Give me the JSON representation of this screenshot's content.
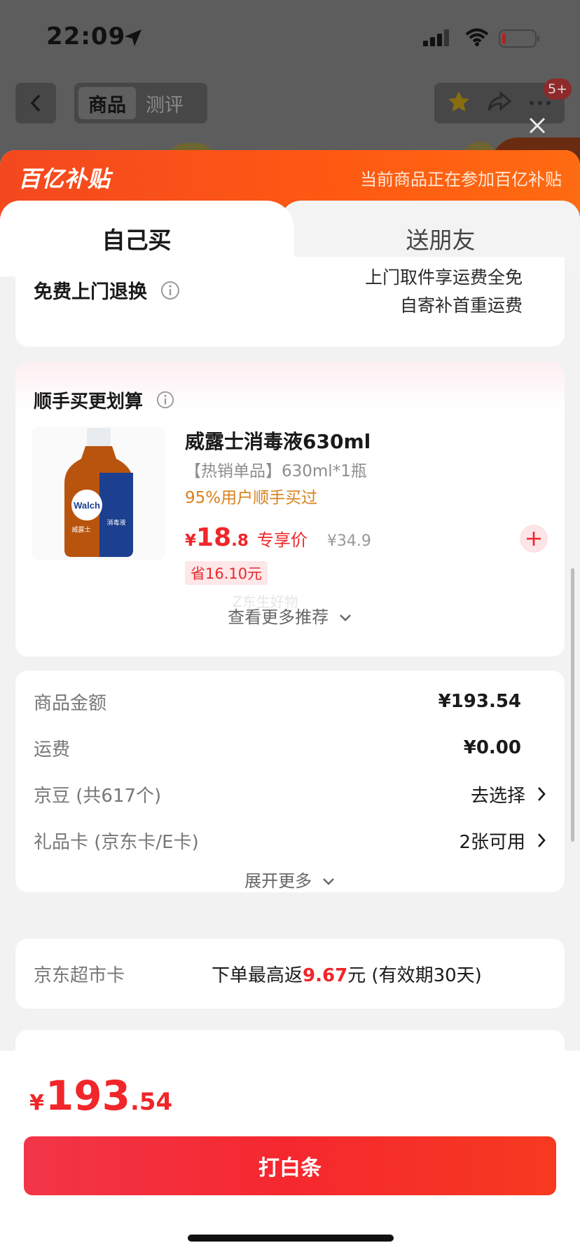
{
  "status": {
    "time": "22:09"
  },
  "nav": {
    "tabs": [
      {
        "label": "商品",
        "active": true
      },
      {
        "label": "测评",
        "active": false
      }
    ],
    "badge": "5+"
  },
  "promo": {
    "logo": "百亿补贴",
    "text": "当前商品正在参加百亿补贴"
  },
  "mode_tabs": {
    "self": "自己买",
    "friend": "送朋友"
  },
  "return_service": {
    "title": "免费上门退换",
    "line1": "上门取件享运费全免",
    "line2": "自寄补首重运费"
  },
  "upsell": {
    "title": "顺手买更划算",
    "product": {
      "name": "威露士消毒液630ml",
      "spec": "【热销单品】630ml*1瓶",
      "rate": "95%用户顺手买过",
      "price_yen": "¥",
      "price_int": "18",
      "price_dec": ".8",
      "price_tag": "专享价",
      "orig_price": "¥34.9",
      "save": "省16.10元",
      "image_brand": "Walch",
      "image_cn": "威露士",
      "image_type": "消毒液"
    },
    "more": "查看更多推荐",
    "watermark": "Z东生好物"
  },
  "summary": {
    "rows": [
      {
        "label": "商品金额",
        "value": "¥193.54"
      },
      {
        "label": "运费",
        "value": "¥0.00"
      },
      {
        "label": "京豆 (共617个)",
        "value": "去选择"
      },
      {
        "label": "礼品卡 (京东卡/E卡)",
        "value": "2张可用"
      }
    ],
    "expand": "展开更多"
  },
  "market_card": {
    "label": "京东超市卡",
    "value_prefix": "下单最高返",
    "value_amount": "9.67",
    "value_suffix": "元 (有效期30天)"
  },
  "footer": {
    "price_yen": "¥",
    "price_int": "193",
    "price_dec": ".54",
    "pay_label": "打白条"
  },
  "colors": {
    "accent": "#f0262a",
    "promo": "#fe5a12",
    "orange_text": "#d8801c"
  }
}
